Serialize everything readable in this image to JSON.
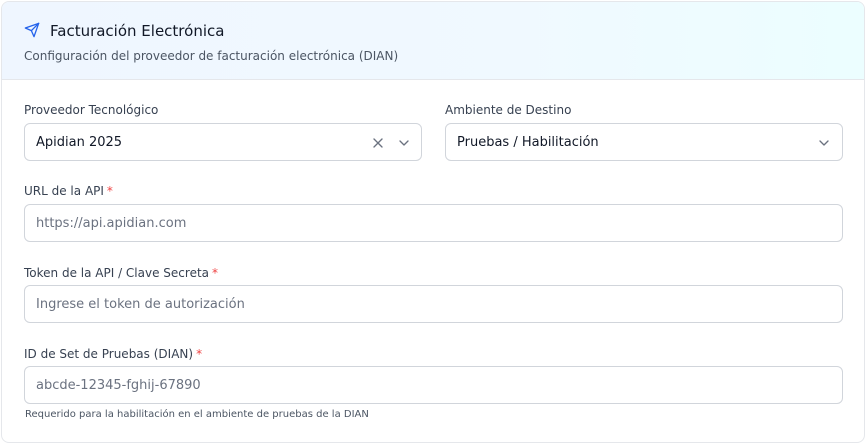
{
  "header": {
    "title": "Facturación Electrónica",
    "subtitle": "Configuración del proveedor de facturación electrónica (DIAN)",
    "icon": "send-icon",
    "accent_color": "#2563eb"
  },
  "form": {
    "provider": {
      "label": "Proveedor Tecnológico",
      "value": "Apidian 2025"
    },
    "environment": {
      "label": "Ambiente de Destino",
      "value": "Pruebas / Habilitación"
    },
    "api_url": {
      "label": "URL de la API",
      "required_mark": "*",
      "placeholder": "https://api.apidian.com"
    },
    "api_token": {
      "label": "Token de la API / Clave Secreta",
      "required_mark": "*",
      "placeholder": "Ingrese el token de autorización"
    },
    "test_set_id": {
      "label": "ID de Set de Pruebas (DIAN)",
      "required_mark": "*",
      "placeholder": "abcde-12345-fghij-67890",
      "hint": "Requerido para la habilitación en el ambiente de pruebas de la DIAN"
    }
  }
}
